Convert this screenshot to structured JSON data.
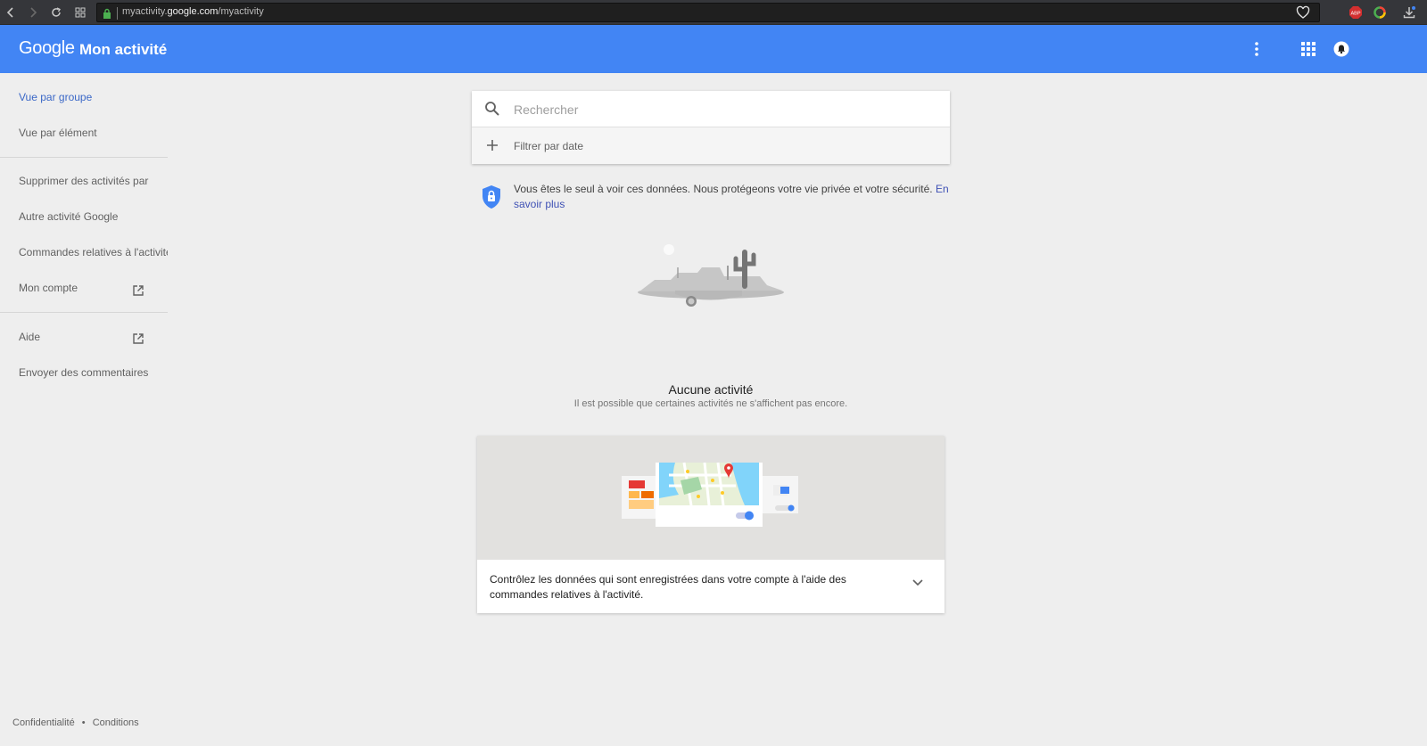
{
  "browser": {
    "url_prefix": "myactivity.",
    "url_host": "google.com",
    "url_path": "/myactivity",
    "extensions": [
      "abp-icon",
      "color-ring-icon",
      "download-icon"
    ]
  },
  "appbar": {
    "logo": "Google",
    "title": "Mon activité",
    "color": "#4285f4"
  },
  "sidebar": {
    "items": [
      {
        "label": "Vue par groupe",
        "active": true
      },
      {
        "label": "Vue par élément"
      },
      {
        "label": "Supprimer des activités par"
      },
      {
        "label": "Autre activité Google"
      },
      {
        "label": "Commandes relatives à l'activité"
      },
      {
        "label": "Mon compte",
        "external": true
      },
      {
        "label": "Aide",
        "external": true
      },
      {
        "label": "Envoyer des commentaires"
      }
    ]
  },
  "footer": {
    "privacy": "Confidentialité",
    "separator": "•",
    "terms": "Conditions"
  },
  "search": {
    "placeholder": "Rechercher",
    "filter_label": "Filtrer par date"
  },
  "privacy_notice": {
    "text": "Vous êtes le seul à voir ces données. Nous protégeons votre vie privée et votre sécurité. ",
    "link": "En savoir plus"
  },
  "empty_state": {
    "title": "Aucune activité",
    "subtitle": "Il est possible que certaines activités ne s'affichent pas encore."
  },
  "promo": {
    "text": "Contrôlez les données qui sont enregistrées dans votre compte à l'aide des commandes relatives à l'activité."
  }
}
